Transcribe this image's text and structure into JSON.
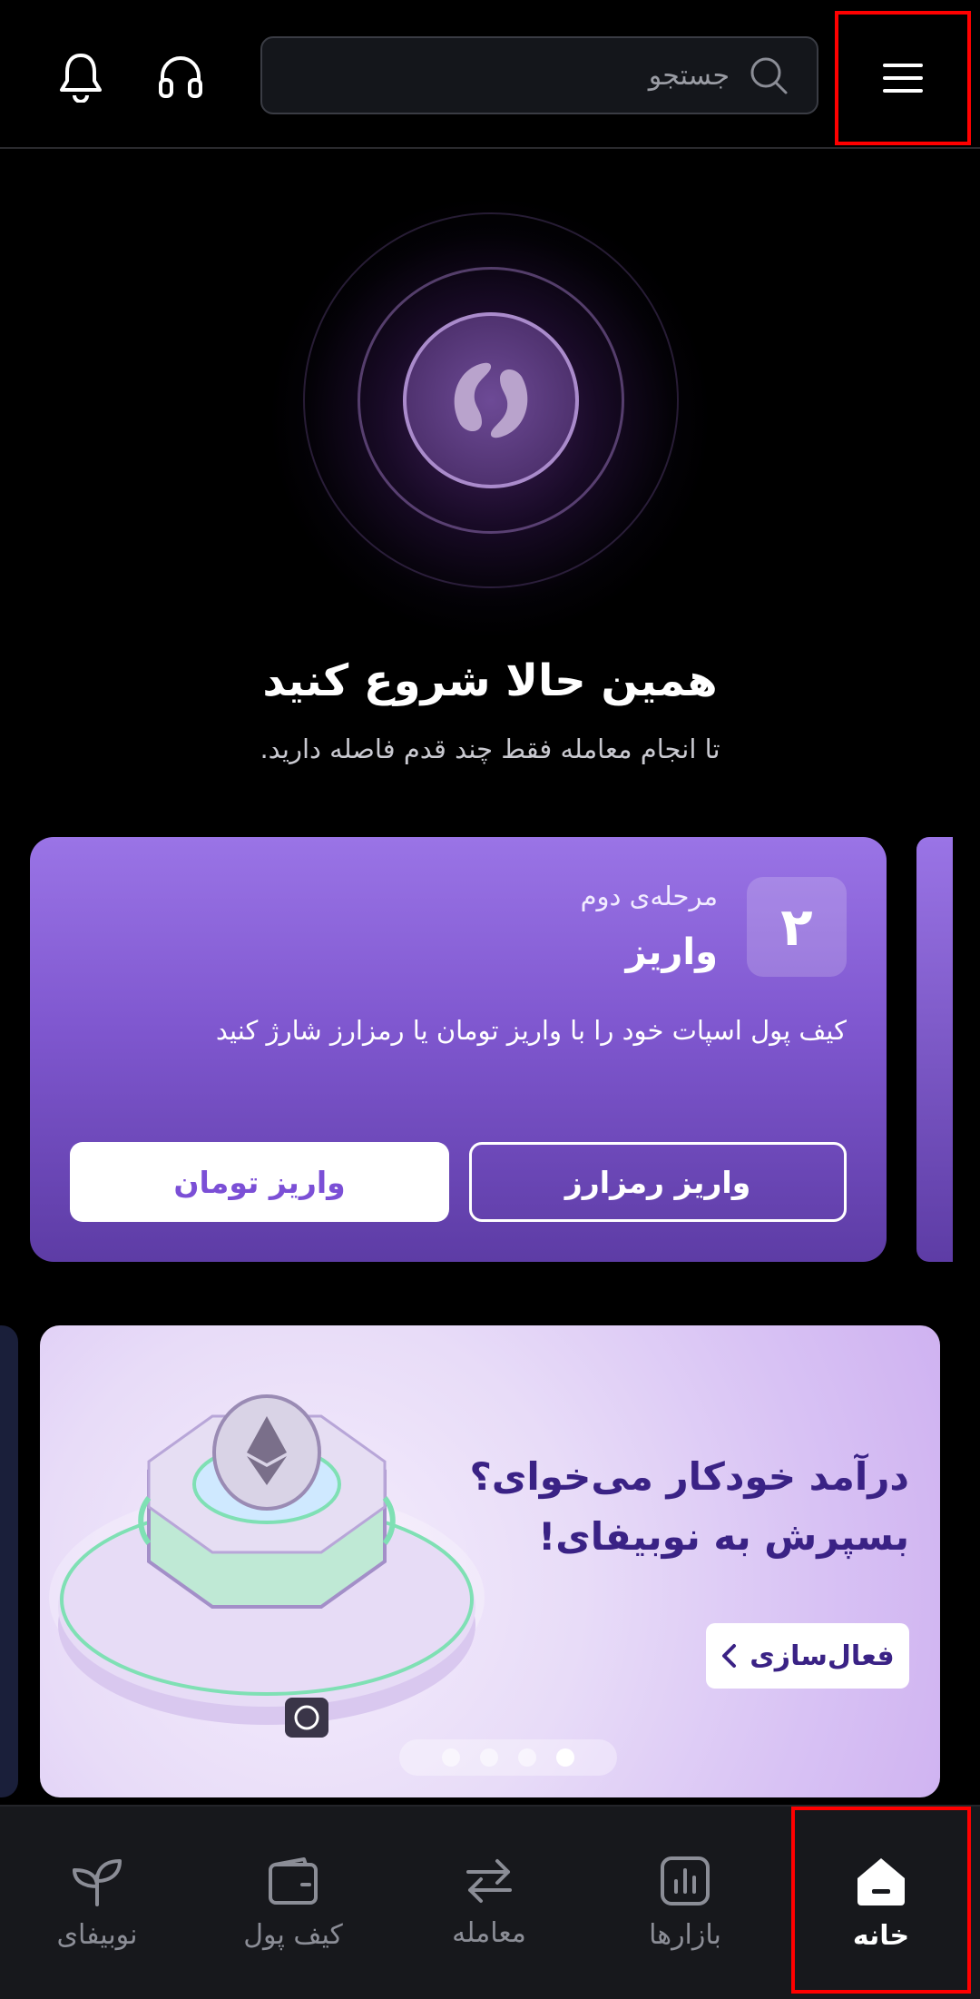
{
  "header": {
    "search_placeholder": "جستجو",
    "icons": [
      "menu-icon",
      "search-icon",
      "headset-icon",
      "bell-icon"
    ]
  },
  "hero": {
    "title": "همین حالا شروع کنید",
    "subtitle": "تا انجام معامله فقط چند قدم فاصله دارید."
  },
  "step_card": {
    "number": "۲",
    "step_label": "مرحله‌ی دوم",
    "title": "واریز",
    "description": "کیف پول اسپات خود را با واریز تومان یا رمزارز شارژ کنید",
    "crypto_button": "واریز رمزارز",
    "toman_button": "واریز تومان"
  },
  "banner": {
    "title_line1": "درآمد خودکار می‌خوای؟",
    "title_line2": "بسپرش به نوبیفای!",
    "activate_button": "فعال‌سازی",
    "dots_count": 4,
    "active_dot": 4
  },
  "bottom_nav": {
    "items": [
      {
        "label": "خانه",
        "icon": "home-icon",
        "active": true
      },
      {
        "label": "بازارها",
        "icon": "chart-icon",
        "active": false
      },
      {
        "label": "معامله",
        "icon": "exchange-icon",
        "active": false
      },
      {
        "label": "کیف پول",
        "icon": "wallet-icon",
        "active": false
      },
      {
        "label": "نوبیفای",
        "icon": "sprout-icon",
        "active": false
      }
    ]
  },
  "colors": {
    "highlight": "#ff0000",
    "card_purple": "#7f57cf",
    "banner_text": "#3a2285",
    "nav_background": "#17181c"
  }
}
